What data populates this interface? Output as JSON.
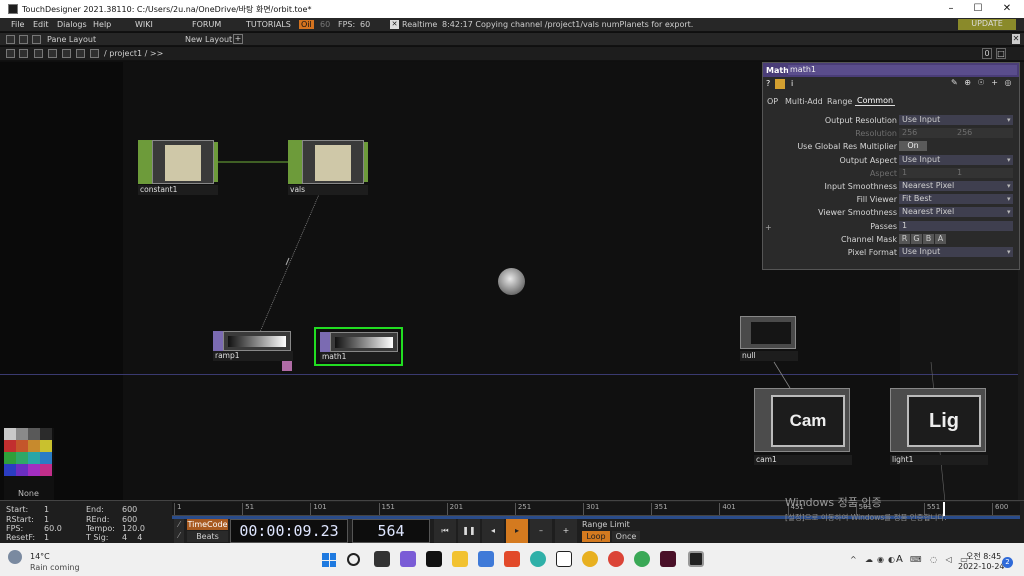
{
  "window": {
    "title": "TouchDesigner 2021.38110: C:/Users/2u.na/OneDrive/바탕 화면/orbit.toe*",
    "controls": [
      "–",
      "☐",
      "✕"
    ]
  },
  "menubar": {
    "items": [
      "File",
      "Edit",
      "Dialogs",
      "Help"
    ],
    "tabs": [
      "WIKI",
      "FORUM",
      "TUTORIALS"
    ],
    "oil_label": "Oil",
    "fps_target": "60",
    "fps_label": "FPS:",
    "fps_value": "60",
    "realtime_label": "Realtime",
    "status_message": "8:42:17 Copying channel /project1/vals numPlanets for export.",
    "update_label": "UPDATE"
  },
  "panebar": {
    "pane_layout_label": "Pane Layout",
    "new_layout_label": "New Layout",
    "add_label": "+"
  },
  "pathbar": {
    "path": "/ project1 / >>",
    "right_values": [
      "0",
      "□"
    ]
  },
  "nodes": {
    "constant1": {
      "label": "constant1",
      "type": "chop"
    },
    "vals": {
      "label": "vals",
      "type": "chop"
    },
    "ramp1": {
      "label": "ramp1",
      "type": "top"
    },
    "math1": {
      "label": "math1",
      "type": "top"
    },
    "null": {
      "label": "null",
      "type": "top"
    },
    "cam1": {
      "label": "cam1",
      "type": "comp",
      "text": "Cam"
    },
    "light1": {
      "label": "light1",
      "type": "comp",
      "text": "Lig"
    }
  },
  "params": {
    "op_type": "Math",
    "op_name": "math1",
    "tabs": [
      "OP",
      "Multi-Add",
      "Range",
      "Common"
    ],
    "active_tab": "Common",
    "rows": [
      {
        "label": "Output Resolution",
        "value": "Use Input",
        "kind": "menu"
      },
      {
        "label": "Resolution",
        "value": "256",
        "value2": "256",
        "kind": "disabled"
      },
      {
        "label": "Use Global Res Multiplier",
        "value": "On",
        "kind": "toggle"
      },
      {
        "label": "Output Aspect",
        "value": "Use Input",
        "kind": "menu"
      },
      {
        "label": "Aspect",
        "value": "1",
        "value2": "1",
        "kind": "disabled"
      },
      {
        "label": "Input Smoothness",
        "value": "Nearest Pixel",
        "kind": "menu"
      },
      {
        "label": "Fill Viewer",
        "value": "Fit Best",
        "kind": "menu"
      },
      {
        "label": "Viewer Smoothness",
        "value": "Nearest Pixel",
        "kind": "menu"
      },
      {
        "label": "Passes",
        "value": "1",
        "kind": "slider"
      },
      {
        "label": "Channel Mask",
        "value": "R G B A",
        "kind": "rgba"
      },
      {
        "label": "Pixel Format",
        "value": "Use Input",
        "kind": "menu"
      }
    ]
  },
  "palette": {
    "none_label": "None",
    "colors": [
      "#c9c9c9",
      "#8a8a8a",
      "#595959",
      "#2b2b2b",
      "#c22f2f",
      "#c4562b",
      "#c78a2d",
      "#c9c12e",
      "#2f9f3a",
      "#2fa867",
      "#2aa6a6",
      "#2b7cc4",
      "#2b3dc2",
      "#6b2ec2",
      "#a22ec2",
      "#c22e8a"
    ]
  },
  "timeline": {
    "start_label": "Start:",
    "start_value": "1",
    "rstart_label": "RStart:",
    "rstart_value": "1",
    "fps_label": "FPS:",
    "fps_value": "60.0",
    "resetf_label": "ResetF:",
    "resetf_value": "1",
    "end_label": "End:",
    "end_value": "600",
    "rend_label": "REnd:",
    "rend_value": "600",
    "tempo_label": "Tempo:",
    "tempo_value": "120.0",
    "tsig_label": "T Sig:",
    "tsig_value": "4    4",
    "ruler_ticks": [
      "1",
      "51",
      "101",
      "151",
      "201",
      "251",
      "301",
      "351",
      "401",
      "451",
      "501",
      "551",
      "600"
    ],
    "timecode_label": "TimeCode",
    "beats_label": "Beats",
    "timecode": "00:00:09.23",
    "frame": "564",
    "range_limit_label": "Range Limit",
    "loop_label": "Loop",
    "once_label": "Once",
    "playhead_fraction": 0.94
  },
  "watermark": {
    "line1": "Windows 정품 인증",
    "line2": "[설정]으로 이동하여 Windows를 정품 인증합니다."
  },
  "taskbar": {
    "weather_temp": "14°C",
    "weather_desc": "Rain coming",
    "time": "오전 8:45",
    "date": "2022-10-24",
    "notification_count": "2",
    "lang": "A"
  }
}
